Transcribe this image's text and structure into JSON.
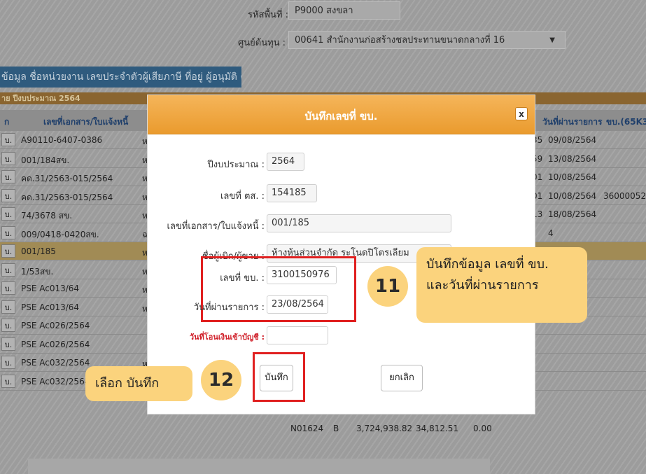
{
  "background": {
    "product_label": "รหัสพื้นที่ :",
    "product_value": "P9000 สงขลา",
    "cost_center_label": "ศูนย์ต้นทุน :",
    "cost_center_value": "00641 สำนักงานก่อสร้างชลประทานขนาดกลางที่ 16",
    "tab_label": "ข้อมูล ชื่อหน่วยงาน เลขประจำตัวผู้เสียภาษี ที่อยู่ ผู้อนุมัติ ตำแหน่ง",
    "year_bar": "าย ปีงบประมาณ 2564",
    "columns": {
      "col1": "ก",
      "doc": "เลขที่เอกสาร/ใบแจ้งหนี้",
      "date": "วันที่ผ่านรายการ",
      "kb": "ขบ.(65K3)"
    },
    "rows": [
      {
        "btn": "บ.",
        "doc": "A90110-6407-0386",
        "c3": "ห",
        "c4": "35",
        "c5": "09/08/2564",
        "c6": ""
      },
      {
        "btn": "บ.",
        "doc": "001/184สข.",
        "c3": "ห",
        "c4": "59",
        "c5": "13/08/2564",
        "c6": ""
      },
      {
        "btn": "บ.",
        "doc": "คด.31/2563-015/2564",
        "c3": "ห",
        "c4": "01",
        "c5": "10/08/2564",
        "c6": ""
      },
      {
        "btn": "บ.",
        "doc": "คด.31/2563-015/2564",
        "c3": "ห",
        "c4": "01",
        "c5": "10/08/2564",
        "c6": "3600005243"
      },
      {
        "btn": "บ.",
        "doc": "74/3678 สข.",
        "c3": "ห",
        "c4": "13",
        "c5": "18/08/2564",
        "c6": ""
      },
      {
        "btn": "บ.",
        "doc": "009/0418-0420สข.",
        "c3": "ฉ",
        "c4": "",
        "c5": "4",
        "c6": ""
      },
      {
        "btn": "บ.",
        "doc": "001/185",
        "c3": "ห",
        "c4": "",
        "c5": "4",
        "c6": ""
      },
      {
        "btn": "บ.",
        "doc": "1/53สข.",
        "c3": "ห",
        "c4": "",
        "c5": "4",
        "c6": ""
      },
      {
        "btn": "บ.",
        "doc": "PSE Ac013/64",
        "c3": "ห",
        "c4": "",
        "c5": "",
        "c6": ""
      },
      {
        "btn": "บ.",
        "doc": "PSE Ac013/64",
        "c3": "ห",
        "c4": "",
        "c5": "",
        "c6": ""
      },
      {
        "btn": "บ.",
        "doc": "PSE Ac026/2564",
        "c3": "",
        "c4": "",
        "c5": "",
        "c6": ""
      },
      {
        "btn": "บ.",
        "doc": "PSE Ac026/2564",
        "c3": "",
        "c4": "",
        "c5": "",
        "c6": ""
      },
      {
        "btn": "บ.",
        "doc": "PSE Ac032/2564",
        "c3": "ห",
        "c4": "",
        "c5": "",
        "c6": ""
      },
      {
        "btn": "บ.",
        "doc": "PSE Ac032/2564",
        "c3": "หจก.พิจิตสุวรรณวิศวกร",
        "c4": "",
        "c5": "",
        "c6": ""
      }
    ],
    "last_row_extra": {
      "code": "N01624",
      "type": "B",
      "amount": "3,724,938.82",
      "tax": "34,812.51",
      "zero": "0.00"
    }
  },
  "modal": {
    "title": "บันทึกเลขที่ ขบ.",
    "close_label": "x",
    "fields": {
      "fiscal_year_label": "ปีงบประมาณ :",
      "fiscal_year_value": "2564",
      "ds_no_label": "เลขที่ ตส. :",
      "ds_no_value": "154185",
      "doc_no_label": "เลขที่เอกสาร/ใบแจ้งหนี้ :",
      "doc_no_value": "001/185",
      "payee_label": "ชื่อผู้เบิก/ผู้ขาย :",
      "payee_value": "ห้างหุ้นส่วนจำกัด ระโนดปิโตรเลียม",
      "kb_no_label": "เลขที่ ขบ. :",
      "kb_no_value": "3100150976",
      "post_date_label": "วันที่ผ่านรายการ :",
      "post_date_value": "23/08/2564",
      "transfer_date_label": "วันที่โอนเงินเข้าบัญชี :",
      "transfer_date_value": ""
    },
    "save_label": "บันทึก",
    "cancel_label": "ยกเลิก"
  },
  "annotations": {
    "step11": "11",
    "step11_line1": "บันทึกข้อมูล เลขที่ ขบ.",
    "step11_line2": "และวันที่ผ่านรายการ",
    "step12": "12",
    "step12_text": "เลือก บันทึก"
  },
  "colors": {
    "modal_header": "#ea9b2e",
    "annotation_fill": "#fbd37d",
    "highlight_border": "#e02020"
  }
}
